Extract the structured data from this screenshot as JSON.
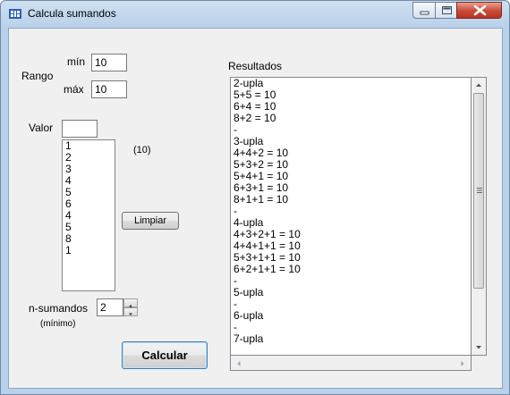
{
  "window": {
    "title": "Calcula sumandos"
  },
  "icons": {
    "app": "app-icon",
    "minimize": "minimize-icon",
    "maximize": "maximize-icon",
    "close": "close-icon"
  },
  "rango": {
    "label": "Rango",
    "min_label": "mín",
    "min_value": "10",
    "max_label": "máx",
    "max_value": "10"
  },
  "valor": {
    "label": "Valor",
    "value": "",
    "items": [
      "1",
      "2",
      "3",
      "4",
      "5",
      "6",
      "4",
      "5",
      "8",
      "1"
    ],
    "count_text": "(10)"
  },
  "limpiar_label": "Limpiar",
  "nsumandos": {
    "label": "n-sumandos",
    "value": "2",
    "hint": "(mínimo)"
  },
  "calcular_label": "Calcular",
  "resultados": {
    "label": "Resultados",
    "lines": [
      "2-upla",
      "5+5 = 10",
      "6+4 = 10",
      "8+2 = 10",
      "-",
      "3-upla",
      "4+4+2 = 10",
      "5+3+2 = 10",
      "5+4+1 = 10",
      "6+3+1 = 10",
      "8+1+1 = 10",
      "-",
      "4-upla",
      "4+3+2+1 = 10",
      "4+4+1+1 = 10",
      "5+3+1+1 = 10",
      "6+2+1+1 = 10",
      "-",
      "5-upla",
      "-",
      "6-upla",
      "-",
      "7-upla"
    ]
  }
}
